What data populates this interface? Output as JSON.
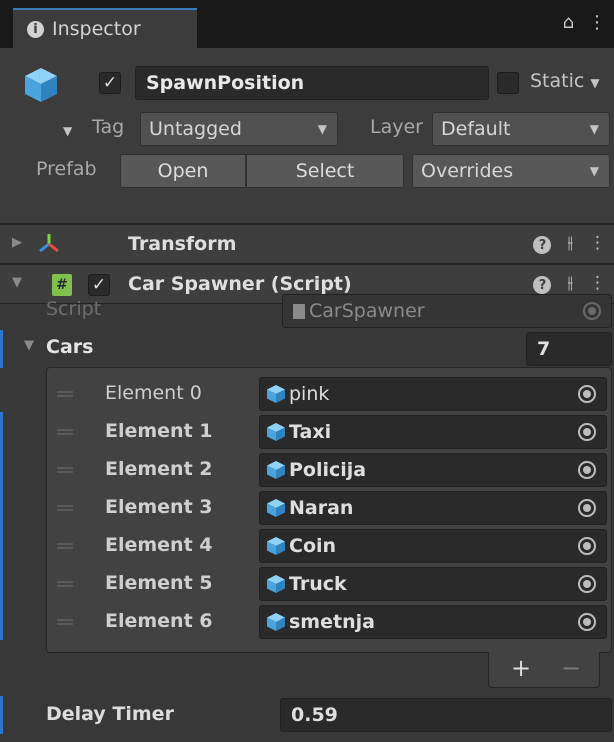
{
  "tab": {
    "title": "Inspector"
  },
  "header": {
    "object_name": "SpawnPosition",
    "active_checked": "✓",
    "static_label": "Static",
    "tag_label": "Tag",
    "tag_value": "Untagged",
    "layer_label": "Layer",
    "layer_value": "Default",
    "prefab_label": "Prefab",
    "open_label": "Open",
    "select_label": "Select",
    "overrides_label": "Overrides"
  },
  "components": {
    "transform": {
      "title": "Transform"
    },
    "car_spawner": {
      "title": "Car Spawner (Script)",
      "enabled_checked": "✓",
      "script_label": "Script",
      "script_value": "CarSpawner",
      "cars_label": "Cars",
      "cars_count": "7",
      "elements": [
        {
          "label": "Element 0",
          "value": "pink"
        },
        {
          "label": "Element 1",
          "value": "Taxi"
        },
        {
          "label": "Element 2",
          "value": "Policija"
        },
        {
          "label": "Element 3",
          "value": "Naran"
        },
        {
          "label": "Element 4",
          "value": "Coin"
        },
        {
          "label": "Element 5",
          "value": "Truck"
        },
        {
          "label": "Element 6",
          "value": "smetnja"
        }
      ],
      "add_label": "+",
      "remove_label": "−",
      "delay_label": "Delay Timer",
      "delay_value": "0.59"
    }
  },
  "colors": {
    "accent_blue": "#2b76c9",
    "prefab_cube": "#5fb3e8"
  }
}
